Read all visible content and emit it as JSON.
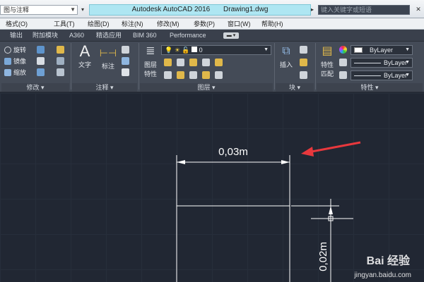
{
  "titlebar": {
    "workspace": "图与注释",
    "app_title": "Autodesk AutoCAD 2016",
    "doc_title": "Drawing1.dwg",
    "search_placeholder": "键入关键字或短语"
  },
  "menu": [
    "格式(O)",
    "工具(T)",
    "绘图(D)",
    "标注(N)",
    "修改(M)",
    "参数(P)",
    "窗口(W)",
    "帮助(H)"
  ],
  "ribbon_tabs": [
    "输出",
    "附加模块",
    "A360",
    "精选应用",
    "BIM 360",
    "Performance"
  ],
  "modify_panel": {
    "rows": [
      "旋转",
      "镜像",
      "缩放"
    ],
    "title": "修改 ▾"
  },
  "annotation_panel": {
    "text_label": "文字",
    "dim_label": "标注",
    "title": "注释 ▾"
  },
  "layer_panel": {
    "layer_props_label_1": "图层",
    "layer_props_label_2": "特性",
    "layer_dropdown": "0",
    "title": "图层 ▾"
  },
  "block_panel": {
    "insert_label": "插入",
    "title": "块 ▾"
  },
  "properties_panel": {
    "match_label_1": "特性",
    "match_label_2": "匹配",
    "color": "ByLayer",
    "linetype": "ByLayer",
    "lineweight": "ByLayer",
    "title": "特性 ▾"
  },
  "drawing": {
    "dim_horizontal": "0,03m",
    "dim_vertical": "0,02m"
  },
  "watermark": {
    "brand": "Bai 经验",
    "url": "jingyan.baidu.com"
  },
  "colors": {
    "canvas": "#212733",
    "ribbon": "#444b57",
    "accent_arrow": "#e8383d",
    "title_highlight": "#aee6f2"
  }
}
